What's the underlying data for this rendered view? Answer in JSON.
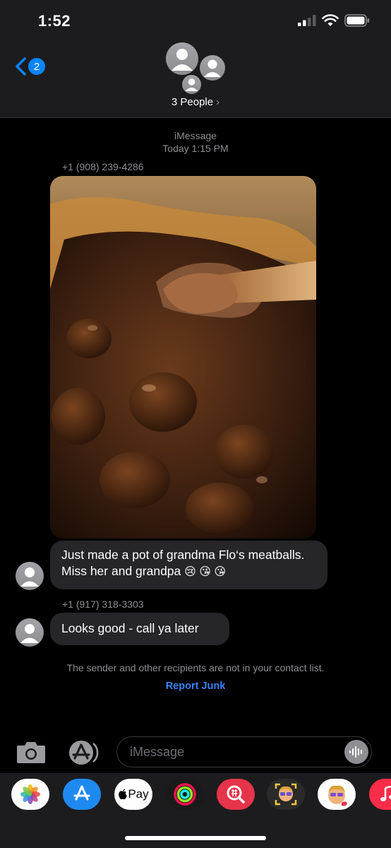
{
  "status": {
    "time": "1:52"
  },
  "header": {
    "back_count": "2",
    "group_name": "3 People",
    "chevron": "›"
  },
  "thread": {
    "service": "iMessage",
    "timestamp": "Today 1:15 PM",
    "messages": [
      {
        "sender": "+1 (908) 239-4286",
        "photo": "meatballs-in-sauce-photo",
        "text": "Just made a pot of grandma Flo‘s meatballs. Miss her and grandpa",
        "emoji": "😢 😘 😘"
      },
      {
        "sender": "+1 (917) 318-3303",
        "text": "Looks good - call ya later"
      }
    ],
    "notice": "The sender and other recipients are not in your contact list.",
    "report_label": "Report Junk"
  },
  "composer": {
    "placeholder": "iMessage"
  },
  "app_drawer": {
    "apps": [
      "photos-icon",
      "app-store-icon",
      "apple-pay-icon",
      "activity-icon",
      "image-search-icon",
      "memoji-icon",
      "memoji-stickers-icon",
      "music-icon"
    ],
    "apple_pay_label": "Pay"
  },
  "colors": {
    "accent": "#0a84ff",
    "bubble": "#262629",
    "background": "#000000",
    "bar": "#1c1c1e"
  }
}
